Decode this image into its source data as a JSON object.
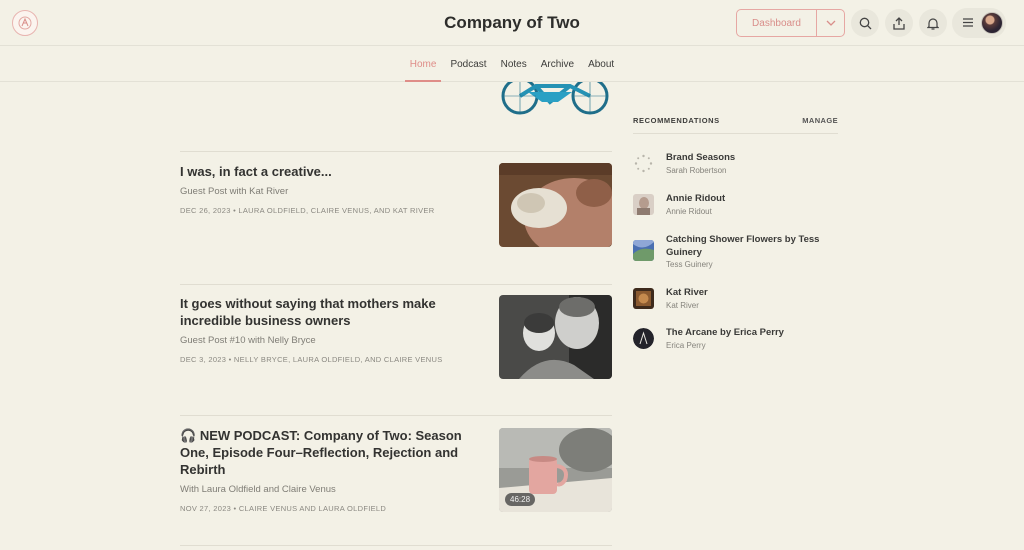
{
  "header": {
    "title": "Company of Two",
    "dashboard_label": "Dashboard",
    "icons": [
      "search-icon",
      "share-icon",
      "bell-icon",
      "menu-icon"
    ],
    "accent": "#df8d88"
  },
  "nav": {
    "items": [
      {
        "label": "Home",
        "active": true
      },
      {
        "label": "Podcast"
      },
      {
        "label": "Notes"
      },
      {
        "label": "Archive"
      },
      {
        "label": "About"
      }
    ]
  },
  "posts": [
    {
      "title": "I was, in fact a creative...",
      "subtitle": "Guest Post with Kat River",
      "meta": "DEC 26, 2023 • LAURA OLDFIELD, CLAIRE VENUS, AND KAT RIVER"
    },
    {
      "title": "It goes without saying that mothers make incredible business owners",
      "subtitle": "Guest Post #10 with Nelly Bryce",
      "meta": "DEC 3, 2023 • NELLY BRYCE, LAURA OLDFIELD, AND CLAIRE VENUS"
    },
    {
      "title": "NEW PODCAST: Company of Two: Season One, Episode Four–Reflection, Rejection and Rebirth",
      "subtitle": "With Laura Oldfield and Claire Venus",
      "meta": "NOV 27, 2023 • CLAIRE VENUS AND LAURA OLDFIELD",
      "duration": "46:28",
      "icon": "headphones-icon"
    }
  ],
  "recommendations": {
    "heading": "RECOMMENDATIONS",
    "manage_label": "MANAGE",
    "items": [
      {
        "name": "Brand Seasons",
        "author": "Sarah Robertson"
      },
      {
        "name": "Annie Ridout",
        "author": "Annie Ridout"
      },
      {
        "name": "Catching Shower Flowers by Tess Guinery",
        "author": "Tess Guinery"
      },
      {
        "name": "Kat River",
        "author": "Kat River"
      },
      {
        "name": "The Arcane by Erica Perry",
        "author": "Erica Perry"
      }
    ]
  }
}
